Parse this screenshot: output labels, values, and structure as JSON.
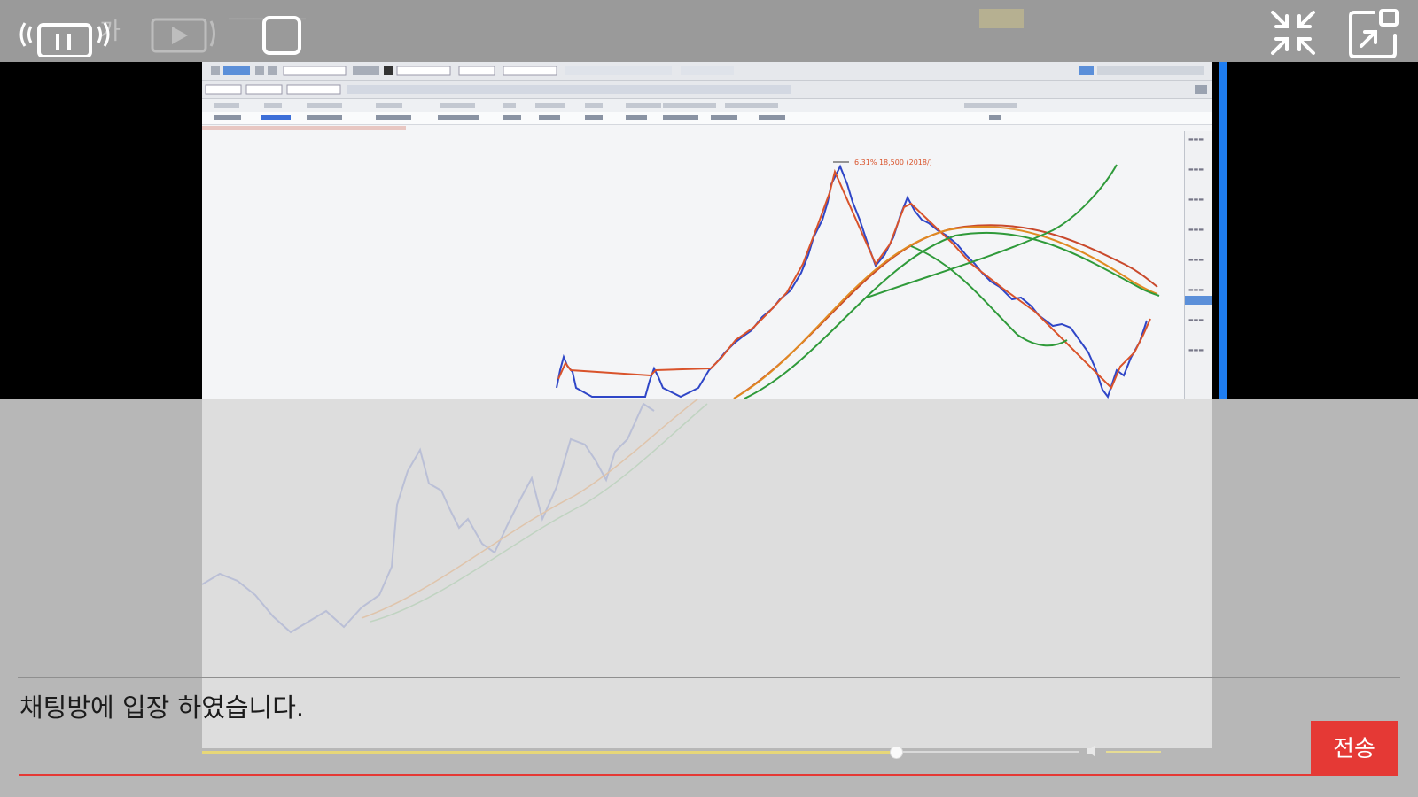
{
  "chat": {
    "system_message": "채팅방에 입장 하였습니다.",
    "send_label": "전송"
  },
  "player": {
    "progress": 0.79,
    "volume": 0.8
  },
  "chart_window": {
    "annotation": "6.31% 18,500 (2018/)"
  },
  "colors": {
    "send_button": "#e53935",
    "timeline": "#e53935",
    "accent_blue": "#1e7df0",
    "candle_up": "#d9532b",
    "candle_down": "#2f46c7",
    "ma_green": "#2f9a3a",
    "ma_orange": "#e08a22",
    "ma_red": "#c9492c"
  },
  "icons": [
    "live-stream-icon",
    "tv-icon",
    "play-icon",
    "stop-square-icon",
    "minimize-icon",
    "popout-icon",
    "volume-icon"
  ]
}
